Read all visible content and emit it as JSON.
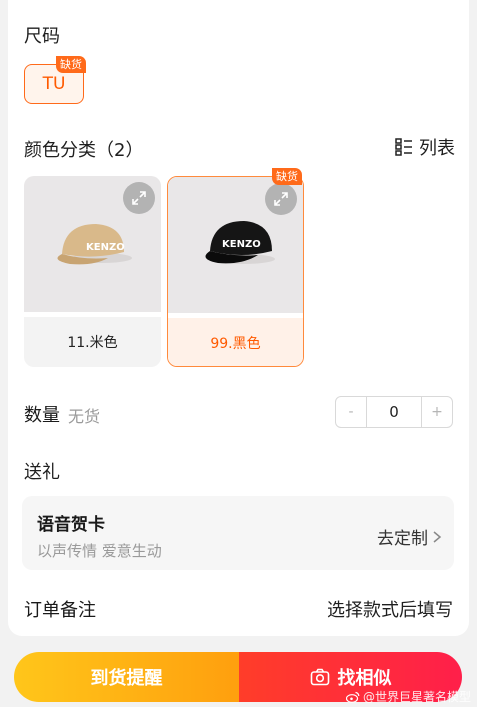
{
  "size": {
    "title": "尺码",
    "chip": "TU",
    "chip_tag": "缺货"
  },
  "color": {
    "title": "颜色分类（2）",
    "list_toggle": "列表",
    "items": [
      {
        "label": "11.米色",
        "tag": ""
      },
      {
        "label": "99.黑色",
        "tag": "缺货"
      }
    ],
    "brand_text": "KENZO"
  },
  "quantity": {
    "label": "数量",
    "status": "无货",
    "value": "0",
    "minus": "-",
    "plus": "+"
  },
  "gift": {
    "title": "送礼",
    "card_title": "语音贺卡",
    "card_subtitle": "以声传情 爱意生动",
    "card_action": "去定制"
  },
  "note": {
    "label": "订单备注",
    "value": "选择款式后填写"
  },
  "actions": {
    "notify": "到货提醒",
    "similar": "找相似"
  },
  "watermark": "@世界巨星著名模型",
  "colors": {
    "accent": "#ff6a1a",
    "notify": "#ffb015",
    "similar": "#ff2d3d"
  }
}
